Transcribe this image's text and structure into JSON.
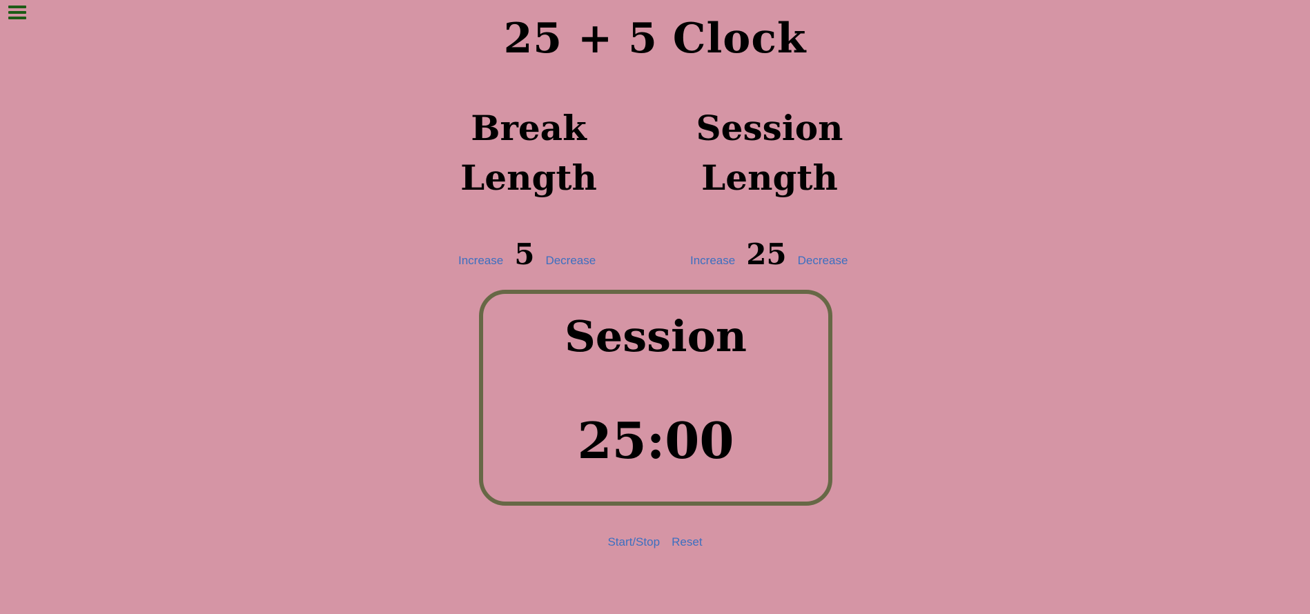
{
  "title": "25 + 5 Clock",
  "break": {
    "label_line1": "Break",
    "label_line2": "Length",
    "increase_label": "Increase",
    "value": "5",
    "decrease_label": "Decrease"
  },
  "session": {
    "label_line1": "Session",
    "label_line2": "Length",
    "increase_label": "Increase",
    "value": "25",
    "decrease_label": "Decrease"
  },
  "timer": {
    "label": "Session",
    "time": "25:00"
  },
  "controls": {
    "start_stop_label": "Start/Stop",
    "reset_label": "Reset"
  },
  "icons": {
    "menu": "hamburger-menu-icon"
  },
  "colors": {
    "background": "#d595a5",
    "menu_icon": "#1d5b16",
    "timer_border": "#676846",
    "link": "#3c6fc0"
  }
}
